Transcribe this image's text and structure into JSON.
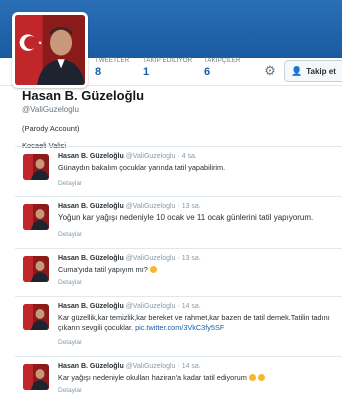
{
  "profile": {
    "name": "Hasan B. Güzeloğlu",
    "handle": "@ValiGuzeloglu",
    "bio": "(Parody Account)",
    "location": "Kocaeli Valisi"
  },
  "stats": [
    {
      "label": "TWEETLER",
      "value": "8"
    },
    {
      "label": "TAKİP EDİLİYOR",
      "value": "1"
    },
    {
      "label": "TAKİPÇİLER",
      "value": "6"
    }
  ],
  "actions": {
    "follow_label": "Takip et",
    "settings_icon": "gear-icon",
    "follow_icon": "add-user-icon"
  },
  "tweets": [
    {
      "name": "Hasan B. Güzeloğlu",
      "handle": "@ValiGuzeloglu",
      "time": "· 4 sa.",
      "text": "Günaydın bakalım çocuklar yarında tatil yapabilirim.",
      "more": "Detaylar"
    },
    {
      "name": "Hasan B. Güzeloğlu",
      "handle": "@ValiGuzeloglu",
      "time": "· 13 sa.",
      "text": "Yoğun kar yağışı nedeniyle  10 ocak ve 11 ocak günlerini tatil yapıyorum.",
      "more": "Detaylar"
    },
    {
      "name": "Hasan B. Güzeloğlu",
      "handle": "@ValiGuzeloglu",
      "time": "· 13 sa.",
      "text": "Cuma'yıda tatil yapıyım mı?",
      "more": "Detaylar"
    },
    {
      "name": "Hasan B. Güzeloğlu",
      "handle": "@ValiGuzeloglu",
      "time": "· 14 sa.",
      "text": "Kar güzellik,kar temizlik,kar bereket ve rahmet,kar bazen de tatil demek.Tatilin tadını çıkarın sevgili çocuklar.",
      "link": "pic.twitter.com/3VkC3fy5SF",
      "more": "Detaylar"
    },
    {
      "name": "Hasan B. Güzeloğlu",
      "handle": "@ValiGuzeloglu",
      "time": "· 14 sa.",
      "text": "Kar yağışı nedeniyle okulları haziran'a kadar tatil ediyorum",
      "more": "Detaylar"
    }
  ],
  "colors": {
    "banner": "#1b5fa6",
    "link": "#1a5fa8",
    "muted": "#8899a6"
  }
}
